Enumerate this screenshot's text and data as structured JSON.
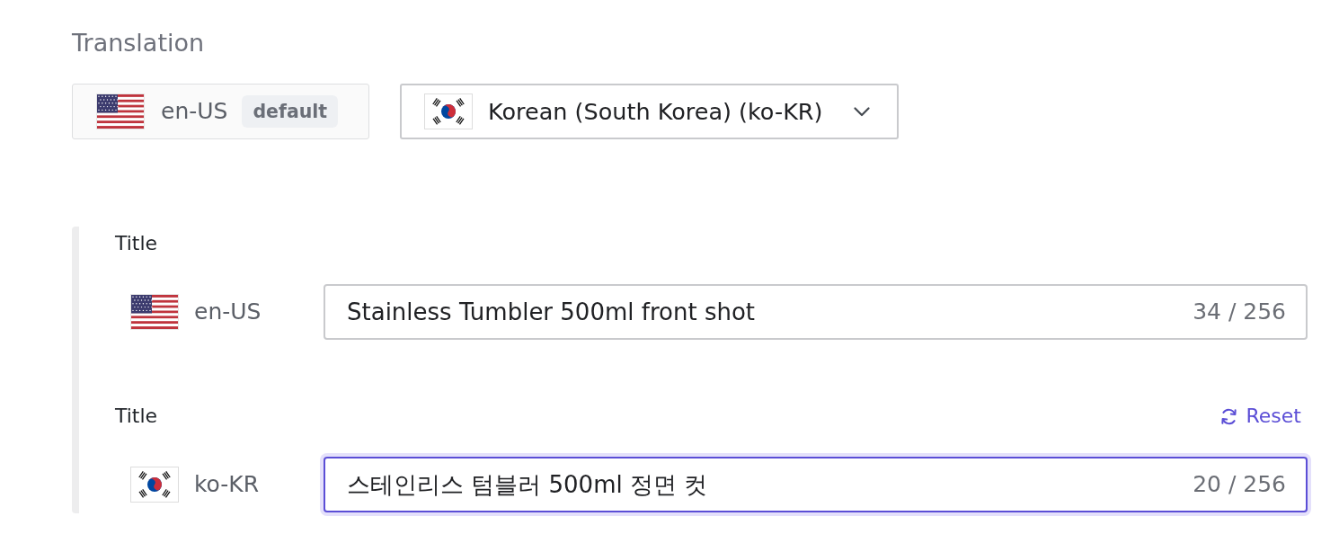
{
  "heading": "Translation",
  "source_locale": {
    "code": "en-US",
    "badge": "default"
  },
  "target_locale": {
    "label": "Korean (South Korea) (ko-KR)"
  },
  "fields": [
    {
      "kind": "source",
      "label": "Title",
      "locale": "en-US",
      "value": "Stainless Tumbler 500ml front shot",
      "counter": "34 / 256",
      "focused": false
    },
    {
      "kind": "target",
      "label": "Title",
      "action": "Reset",
      "locale": "ko-KR",
      "value": "스테인리스 텀블러 500ml 정면 컷",
      "counter": "20 / 256",
      "focused": true
    }
  ]
}
